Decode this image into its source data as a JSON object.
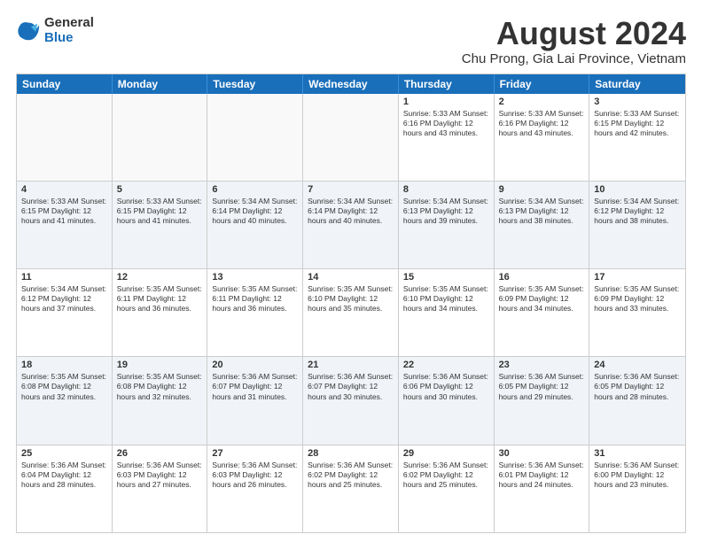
{
  "logo": {
    "general": "General",
    "blue": "Blue"
  },
  "title": "August 2024",
  "subtitle": "Chu Prong, Gia Lai Province, Vietnam",
  "weekdays": [
    "Sunday",
    "Monday",
    "Tuesday",
    "Wednesday",
    "Thursday",
    "Friday",
    "Saturday"
  ],
  "rows": [
    [
      {
        "day": "",
        "info": ""
      },
      {
        "day": "",
        "info": ""
      },
      {
        "day": "",
        "info": ""
      },
      {
        "day": "",
        "info": ""
      },
      {
        "day": "1",
        "info": "Sunrise: 5:33 AM\nSunset: 6:16 PM\nDaylight: 12 hours and 43 minutes."
      },
      {
        "day": "2",
        "info": "Sunrise: 5:33 AM\nSunset: 6:16 PM\nDaylight: 12 hours and 43 minutes."
      },
      {
        "day": "3",
        "info": "Sunrise: 5:33 AM\nSunset: 6:15 PM\nDaylight: 12 hours and 42 minutes."
      }
    ],
    [
      {
        "day": "4",
        "info": "Sunrise: 5:33 AM\nSunset: 6:15 PM\nDaylight: 12 hours and 41 minutes."
      },
      {
        "day": "5",
        "info": "Sunrise: 5:33 AM\nSunset: 6:15 PM\nDaylight: 12 hours and 41 minutes."
      },
      {
        "day": "6",
        "info": "Sunrise: 5:34 AM\nSunset: 6:14 PM\nDaylight: 12 hours and 40 minutes."
      },
      {
        "day": "7",
        "info": "Sunrise: 5:34 AM\nSunset: 6:14 PM\nDaylight: 12 hours and 40 minutes."
      },
      {
        "day": "8",
        "info": "Sunrise: 5:34 AM\nSunset: 6:13 PM\nDaylight: 12 hours and 39 minutes."
      },
      {
        "day": "9",
        "info": "Sunrise: 5:34 AM\nSunset: 6:13 PM\nDaylight: 12 hours and 38 minutes."
      },
      {
        "day": "10",
        "info": "Sunrise: 5:34 AM\nSunset: 6:12 PM\nDaylight: 12 hours and 38 minutes."
      }
    ],
    [
      {
        "day": "11",
        "info": "Sunrise: 5:34 AM\nSunset: 6:12 PM\nDaylight: 12 hours and 37 minutes."
      },
      {
        "day": "12",
        "info": "Sunrise: 5:35 AM\nSunset: 6:11 PM\nDaylight: 12 hours and 36 minutes."
      },
      {
        "day": "13",
        "info": "Sunrise: 5:35 AM\nSunset: 6:11 PM\nDaylight: 12 hours and 36 minutes."
      },
      {
        "day": "14",
        "info": "Sunrise: 5:35 AM\nSunset: 6:10 PM\nDaylight: 12 hours and 35 minutes."
      },
      {
        "day": "15",
        "info": "Sunrise: 5:35 AM\nSunset: 6:10 PM\nDaylight: 12 hours and 34 minutes."
      },
      {
        "day": "16",
        "info": "Sunrise: 5:35 AM\nSunset: 6:09 PM\nDaylight: 12 hours and 34 minutes."
      },
      {
        "day": "17",
        "info": "Sunrise: 5:35 AM\nSunset: 6:09 PM\nDaylight: 12 hours and 33 minutes."
      }
    ],
    [
      {
        "day": "18",
        "info": "Sunrise: 5:35 AM\nSunset: 6:08 PM\nDaylight: 12 hours and 32 minutes."
      },
      {
        "day": "19",
        "info": "Sunrise: 5:35 AM\nSunset: 6:08 PM\nDaylight: 12 hours and 32 minutes."
      },
      {
        "day": "20",
        "info": "Sunrise: 5:36 AM\nSunset: 6:07 PM\nDaylight: 12 hours and 31 minutes."
      },
      {
        "day": "21",
        "info": "Sunrise: 5:36 AM\nSunset: 6:07 PM\nDaylight: 12 hours and 30 minutes."
      },
      {
        "day": "22",
        "info": "Sunrise: 5:36 AM\nSunset: 6:06 PM\nDaylight: 12 hours and 30 minutes."
      },
      {
        "day": "23",
        "info": "Sunrise: 5:36 AM\nSunset: 6:05 PM\nDaylight: 12 hours and 29 minutes."
      },
      {
        "day": "24",
        "info": "Sunrise: 5:36 AM\nSunset: 6:05 PM\nDaylight: 12 hours and 28 minutes."
      }
    ],
    [
      {
        "day": "25",
        "info": "Sunrise: 5:36 AM\nSunset: 6:04 PM\nDaylight: 12 hours and 28 minutes."
      },
      {
        "day": "26",
        "info": "Sunrise: 5:36 AM\nSunset: 6:03 PM\nDaylight: 12 hours and 27 minutes."
      },
      {
        "day": "27",
        "info": "Sunrise: 5:36 AM\nSunset: 6:03 PM\nDaylight: 12 hours and 26 minutes."
      },
      {
        "day": "28",
        "info": "Sunrise: 5:36 AM\nSunset: 6:02 PM\nDaylight: 12 hours and 25 minutes."
      },
      {
        "day": "29",
        "info": "Sunrise: 5:36 AM\nSunset: 6:02 PM\nDaylight: 12 hours and 25 minutes."
      },
      {
        "day": "30",
        "info": "Sunrise: 5:36 AM\nSunset: 6:01 PM\nDaylight: 12 hours and 24 minutes."
      },
      {
        "day": "31",
        "info": "Sunrise: 5:36 AM\nSunset: 6:00 PM\nDaylight: 12 hours and 23 minutes."
      }
    ]
  ]
}
